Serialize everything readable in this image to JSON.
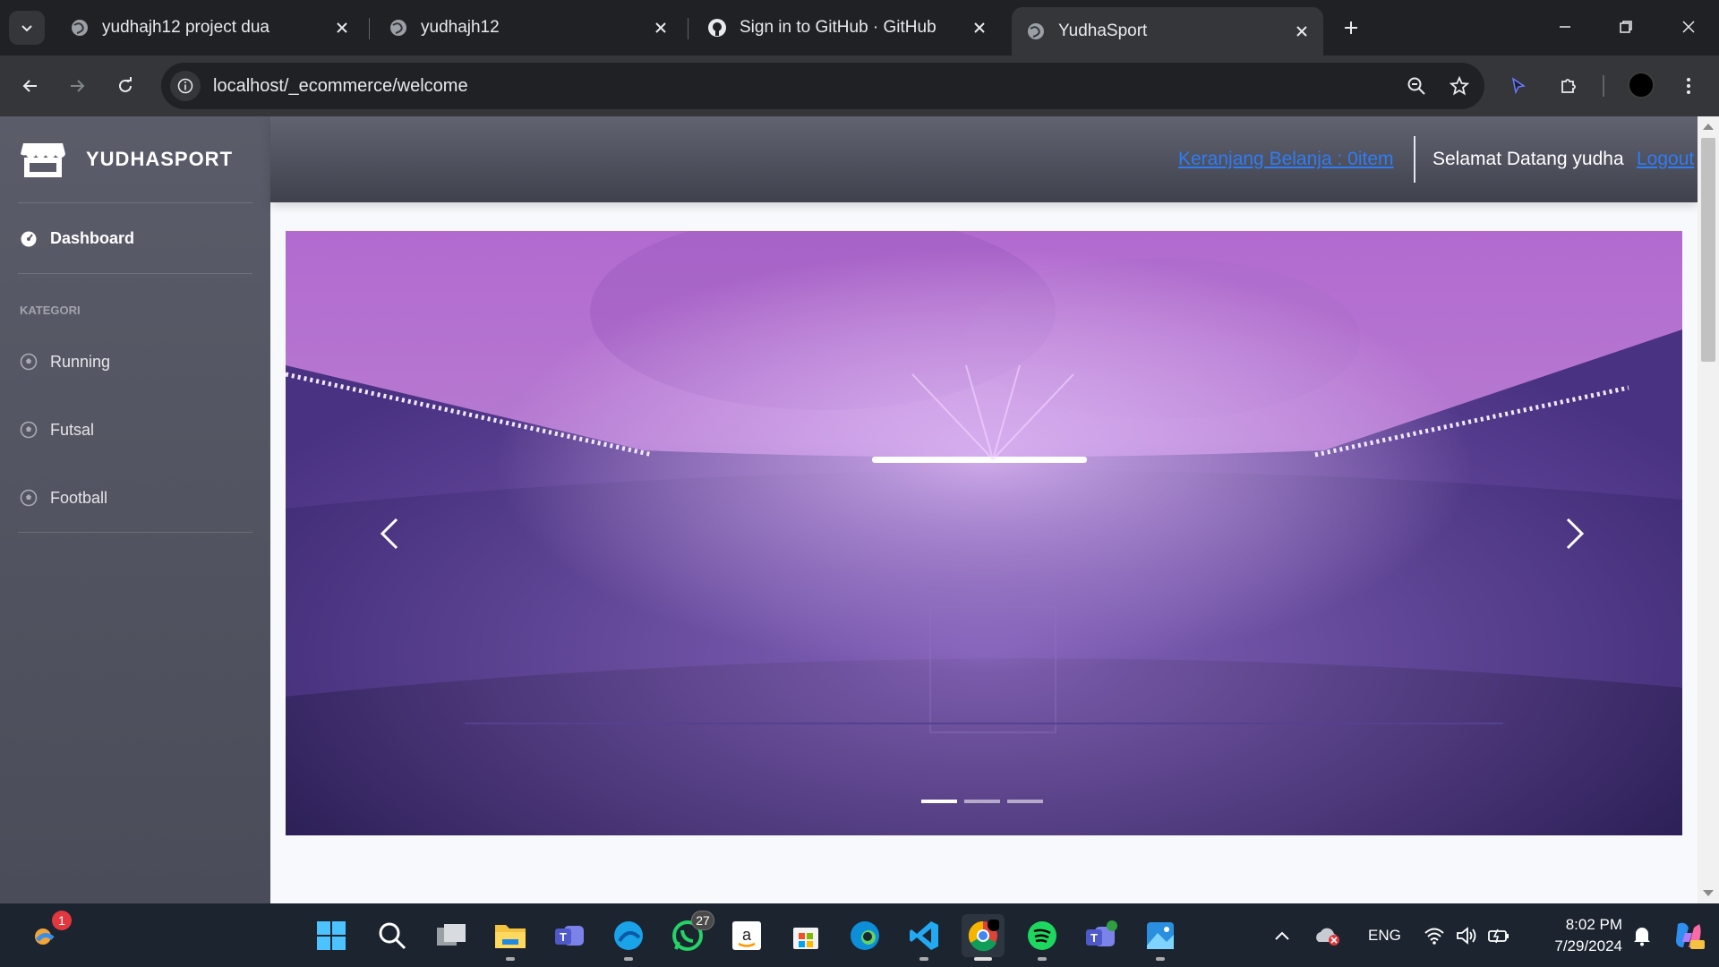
{
  "browser": {
    "tabs": [
      {
        "title": "yudhajh12 project dua",
        "active": false
      },
      {
        "title": "yudhajh12",
        "active": false
      },
      {
        "title": "Sign in to GitHub · GitHub",
        "active": false
      },
      {
        "title": "YudhaSport",
        "active": true
      }
    ],
    "url": "localhost/_ecommerce/welcome"
  },
  "sidebar": {
    "brand": "YUDHASPORT",
    "dashboard_label": "Dashboard",
    "heading": "KATEGORI",
    "categories": [
      {
        "label": "Running"
      },
      {
        "label": "Futsal"
      },
      {
        "label": "Football"
      }
    ]
  },
  "topbar": {
    "cart_link": "Keranjang Belanja : 0item",
    "welcome_text": "Selamat Datang yudha",
    "logout_link": "Logout"
  },
  "carousel": {
    "slide_count": 3,
    "active_index": 0,
    "image_description_icon": "stadium-image"
  },
  "taskbar": {
    "notification_badge": "1",
    "whatsapp_badge": "27",
    "language": "ENG",
    "time": "8:02 PM",
    "date": "7/29/2024"
  },
  "colors": {
    "sidebar": "#5a5c69",
    "link": "#2f7cf6",
    "carousel_sky": "#b26ad0",
    "carousel_stadium": "#3d2a74"
  }
}
